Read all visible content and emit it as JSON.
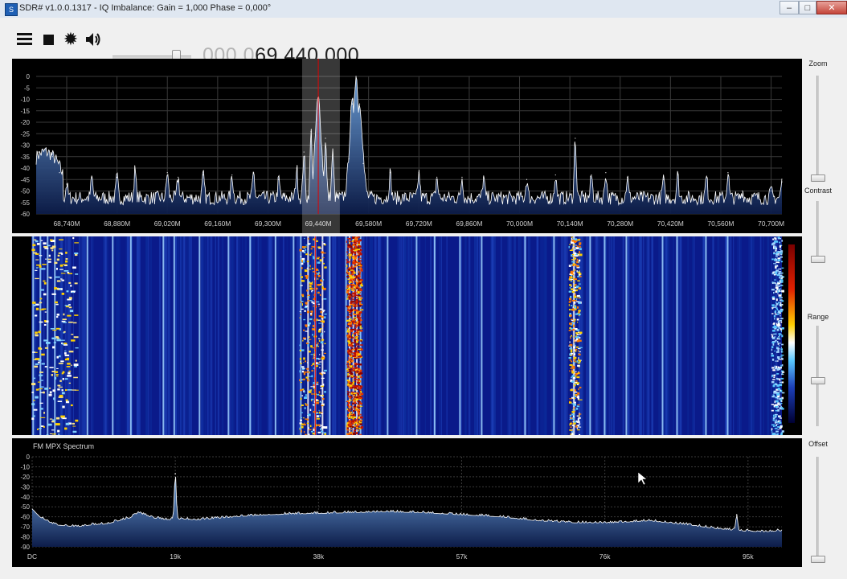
{
  "window": {
    "title": "SDR# v1.0.0.1317 - IQ Imbalance: Gain = 1,000 Phase = 0,000°",
    "app_icon_text": "S",
    "min_glyph": "–",
    "max_glyph": "□",
    "close_glyph": "✕"
  },
  "toolbar": {
    "menu_icon": "hamburger-icon",
    "stop_icon": "stop-icon",
    "settings_icon": "gear-icon",
    "audio_icon": "speaker-icon",
    "gear_glyph": "✹",
    "speaker_glyph": "🔊",
    "volume_level": 0.8,
    "frequency_dim": "000.0",
    "frequency_bright": "69.440.000"
  },
  "sidebar": {
    "zoom_label": "Zoom",
    "contrast_label": "Contrast",
    "range_label": "Range",
    "offset_label": "Offset",
    "zoom_level": 0.0,
    "contrast_level": 0.0,
    "range_level": 0.18,
    "offset_level": 0.0
  },
  "colors": {
    "spectrum_fill_top": "#6ea2dc",
    "spectrum_fill_bottom": "#0d1d4a",
    "trace": "#ffffff",
    "grid": "#3a3a3a",
    "marker": "#e00000",
    "waterfall_bg": "#0a1a8a"
  },
  "chart_data": [
    {
      "type": "area",
      "title": "",
      "xlabel": "",
      "ylabel": "",
      "x_ticks": [
        "68,740M",
        "68,880M",
        "69,020M",
        "69,160M",
        "69,300M",
        "69,440M",
        "69,580M",
        "69,720M",
        "69,860M",
        "70,000M",
        "70,140M",
        "70,280M",
        "70,420M",
        "70,560M",
        "70,700M"
      ],
      "x_tick_values": [
        68.74,
        68.88,
        69.02,
        69.16,
        69.3,
        69.44,
        69.58,
        69.72,
        69.86,
        70.0,
        70.14,
        70.28,
        70.42,
        70.56,
        70.7
      ],
      "y_ticks": [
        "0",
        "-5",
        "-10",
        "-15",
        "-20",
        "-25",
        "-30",
        "-35",
        "-40",
        "-45",
        "-50",
        "-55",
        "-60"
      ],
      "xlim": [
        68.655,
        70.73
      ],
      "ylim": [
        -60,
        0
      ],
      "tuned_frequency_mhz": 69.44,
      "filter_band_mhz": [
        69.395,
        69.5
      ],
      "baseline_db": -53,
      "peaks": [
        {
          "x": 68.66,
          "y": -33
        },
        {
          "x": 68.68,
          "y": -32
        },
        {
          "x": 68.7,
          "y": -35
        },
        {
          "x": 68.72,
          "y": -42
        },
        {
          "x": 68.74,
          "y": -47
        },
        {
          "x": 68.81,
          "y": -44
        },
        {
          "x": 68.88,
          "y": -44
        },
        {
          "x": 68.93,
          "y": -41
        },
        {
          "x": 69.02,
          "y": -42
        },
        {
          "x": 69.05,
          "y": -44
        },
        {
          "x": 69.12,
          "y": -43
        },
        {
          "x": 69.2,
          "y": -43
        },
        {
          "x": 69.26,
          "y": -42
        },
        {
          "x": 69.33,
          "y": -45
        },
        {
          "x": 69.38,
          "y": -40
        },
        {
          "x": 69.4,
          "y": -33
        },
        {
          "x": 69.42,
          "y": -24
        },
        {
          "x": 69.44,
          "y": -10
        },
        {
          "x": 69.46,
          "y": -27
        },
        {
          "x": 69.48,
          "y": -33
        },
        {
          "x": 69.525,
          "y": -36
        },
        {
          "x": 69.535,
          "y": -12
        },
        {
          "x": 69.545,
          "y": 0
        },
        {
          "x": 69.555,
          "y": -12
        },
        {
          "x": 69.565,
          "y": -38
        },
        {
          "x": 69.64,
          "y": -42
        },
        {
          "x": 69.72,
          "y": -42
        },
        {
          "x": 69.77,
          "y": -44
        },
        {
          "x": 69.84,
          "y": -44
        },
        {
          "x": 69.9,
          "y": -44
        },
        {
          "x": 70.02,
          "y": -45
        },
        {
          "x": 70.1,
          "y": -43
        },
        {
          "x": 70.155,
          "y": -27
        },
        {
          "x": 70.2,
          "y": -43
        },
        {
          "x": 70.24,
          "y": -42
        },
        {
          "x": 70.3,
          "y": -44
        },
        {
          "x": 70.4,
          "y": -45
        },
        {
          "x": 70.44,
          "y": -43
        },
        {
          "x": 70.52,
          "y": -44
        },
        {
          "x": 70.58,
          "y": -42
        },
        {
          "x": 70.62,
          "y": -50
        },
        {
          "x": 70.7,
          "y": -50
        },
        {
          "x": 70.73,
          "y": -46
        }
      ]
    },
    {
      "type": "area",
      "title": "FM MPX Spectrum",
      "xlabel": "",
      "ylabel": "",
      "x_ticks": [
        "DC",
        "19k",
        "38k",
        "57k",
        "76k",
        "95k"
      ],
      "x_tick_values": [
        0,
        19,
        38,
        57,
        76,
        95
      ],
      "y_ticks": [
        "0",
        "-10",
        "-20",
        "-30",
        "-40",
        "-50",
        "-60",
        "-70",
        "-80",
        "-90"
      ],
      "xlim": [
        0,
        99.5
      ],
      "ylim": [
        -90,
        0
      ],
      "curve": [
        {
          "x": 0,
          "y": -52
        },
        {
          "x": 1,
          "y": -60
        },
        {
          "x": 3,
          "y": -68
        },
        {
          "x": 6,
          "y": -70
        },
        {
          "x": 8,
          "y": -68
        },
        {
          "x": 10,
          "y": -67
        },
        {
          "x": 12,
          "y": -63
        },
        {
          "x": 13,
          "y": -61
        },
        {
          "x": 14,
          "y": -56
        },
        {
          "x": 15,
          "y": -58
        },
        {
          "x": 16,
          "y": -61
        },
        {
          "x": 18,
          "y": -63
        },
        {
          "x": 19,
          "y": -62
        },
        {
          "x": 22,
          "y": -63
        },
        {
          "x": 27,
          "y": -60
        },
        {
          "x": 31,
          "y": -58
        },
        {
          "x": 36,
          "y": -57
        },
        {
          "x": 42,
          "y": -56
        },
        {
          "x": 47,
          "y": -55
        },
        {
          "x": 52,
          "y": -56
        },
        {
          "x": 57,
          "y": -58
        },
        {
          "x": 62,
          "y": -60
        },
        {
          "x": 67,
          "y": -64
        },
        {
          "x": 72,
          "y": -66
        },
        {
          "x": 77,
          "y": -66
        },
        {
          "x": 82,
          "y": -64
        },
        {
          "x": 87,
          "y": -68
        },
        {
          "x": 91,
          "y": -72
        },
        {
          "x": 94,
          "y": -74
        },
        {
          "x": 97,
          "y": -75
        },
        {
          "x": 99.5,
          "y": -74
        }
      ],
      "spikes": [
        {
          "x": 19.0,
          "y": -17
        },
        {
          "x": 93.5,
          "y": -58
        }
      ]
    }
  ]
}
